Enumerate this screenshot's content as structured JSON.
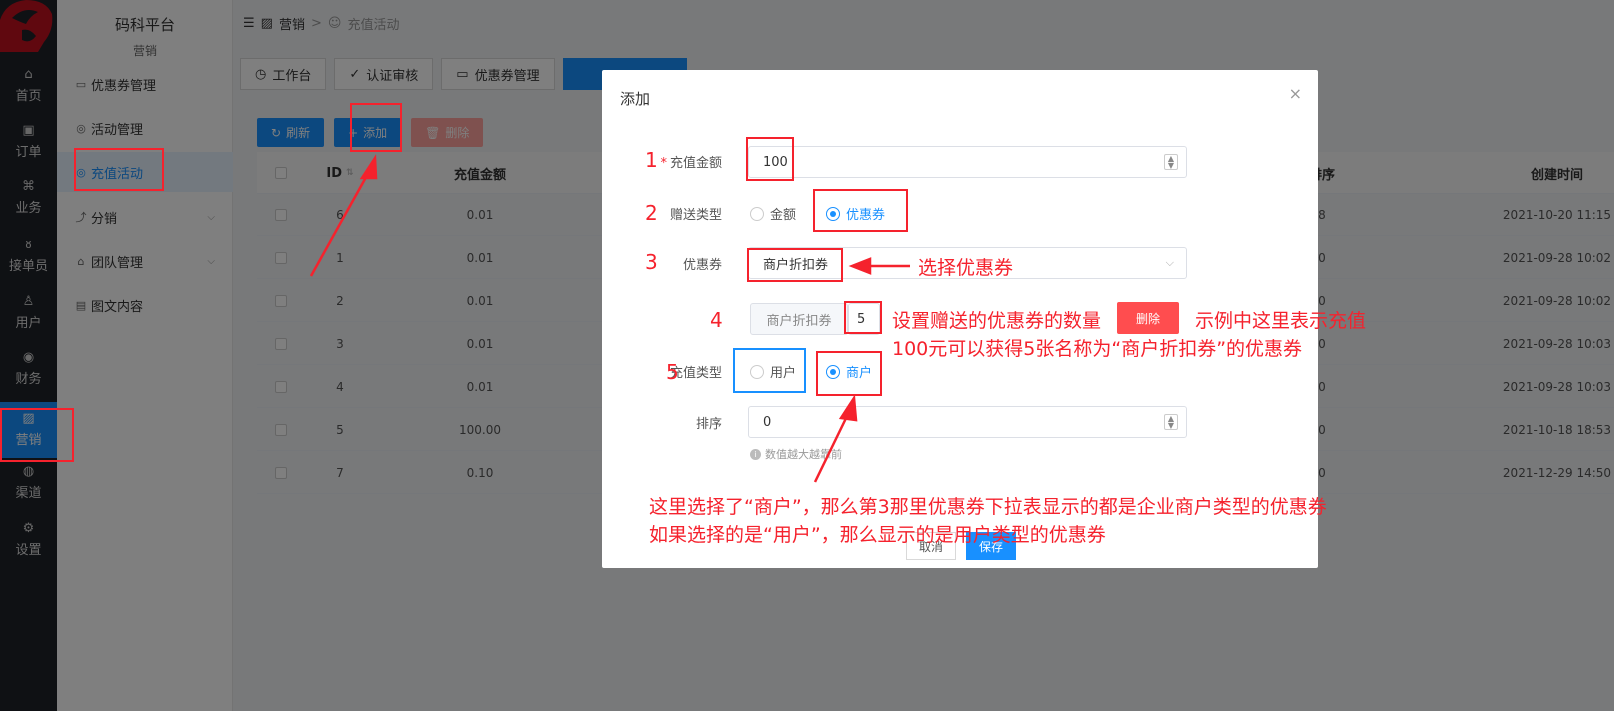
{
  "rail": {
    "items": [
      {
        "label": "首页",
        "icon": "home-icon",
        "glyph": "⌂"
      },
      {
        "label": "订单",
        "icon": "order-icon",
        "glyph": "▣"
      },
      {
        "label": "业务",
        "icon": "business-icon",
        "glyph": "⌘"
      },
      {
        "label": "接单员",
        "icon": "bike-icon",
        "glyph": "ᴕ"
      },
      {
        "label": "用户",
        "icon": "user-icon",
        "glyph": "♙"
      },
      {
        "label": "财务",
        "icon": "finance-icon",
        "glyph": "◉"
      },
      {
        "label": "营销",
        "icon": "marketing-icon",
        "glyph": "▨"
      },
      {
        "label": "渠道",
        "icon": "channel-icon",
        "glyph": "◍"
      },
      {
        "label": "设置",
        "icon": "settings-icon",
        "glyph": "⚙"
      }
    ]
  },
  "menu": {
    "brand": "码科平台",
    "section": "营销",
    "items": [
      {
        "label": "优惠券管理",
        "glyph": "▭"
      },
      {
        "label": "活动管理",
        "glyph": "◎"
      },
      {
        "label": "充值活动",
        "glyph": "◎"
      },
      {
        "label": "分销",
        "glyph": "⤴"
      },
      {
        "label": "团队管理",
        "glyph": "⌂"
      },
      {
        "label": "图文内容",
        "glyph": "▤"
      }
    ]
  },
  "breadcrumb": {
    "first": "营销",
    "sep": ">",
    "second": "充值活动"
  },
  "tabs": [
    {
      "label": "工作台",
      "glyph": "◷"
    },
    {
      "label": "认证审核",
      "glyph": "✓"
    },
    {
      "label": "优惠券管理",
      "glyph": "▭"
    }
  ],
  "toolbar": {
    "refresh": "刷新",
    "add": "添加",
    "delete": "删除"
  },
  "table": {
    "headers": {
      "id": "ID",
      "amount": "充值金额",
      "sort": "排序",
      "created": "创建时间"
    },
    "rows": [
      {
        "id": "6",
        "amount": "0.01",
        "sort": "8",
        "created": "2021-10-20 11:15"
      },
      {
        "id": "1",
        "amount": "0.01",
        "sort": "0",
        "created": "2021-09-28 10:02"
      },
      {
        "id": "2",
        "amount": "0.01",
        "sort": "0",
        "created": "2021-09-28 10:02"
      },
      {
        "id": "3",
        "amount": "0.01",
        "sort": "0",
        "created": "2021-09-28 10:03"
      },
      {
        "id": "4",
        "amount": "0.01",
        "sort": "0",
        "created": "2021-09-28 10:03"
      },
      {
        "id": "5",
        "amount": "100.00",
        "sort": "0",
        "created": "2021-10-18 18:53"
      },
      {
        "id": "7",
        "amount": "0.10",
        "sort": "0",
        "created": "2021-12-29 14:50"
      }
    ]
  },
  "dialog": {
    "title": "添加",
    "close": "×",
    "amount_label": "充值金额",
    "amount_value": "100",
    "gift_type_label": "赠送类型",
    "gift_opt_amount": "金额",
    "gift_opt_coupon": "优惠券",
    "coupon_label": "优惠券",
    "coupon_selected": "商户折扣券",
    "coupon_name": "商户折扣券",
    "coupon_qty": "5",
    "delete_btn": "删除",
    "recharge_type_label": "充值类型",
    "rt_user": "用户",
    "rt_merchant": "商户",
    "sort_label": "排序",
    "sort_value": "0",
    "hint": "数值越大越靠前",
    "cancel": "取消",
    "save": "保存"
  },
  "annotations": {
    "n1": "1",
    "n2": "2",
    "n3": "3",
    "n4": "4",
    "n5": "5",
    "select_coupon": "选择优惠券",
    "qty_note_a": "设置赠送的优惠券的数量",
    "qty_note_b": "示例中这里表示充值",
    "qty_note_c": "100元可以获得5张名称为“商户折扣券”的优惠券",
    "merchant_note_1": "这里选择了“商户”，那么第3那里优惠券下拉表显示的都是企业商户类型的优惠券",
    "merchant_note_2": "如果选择的是“用户”，那么显示的是用户类型的优惠券"
  },
  "colors": {
    "accent": "#1890ff",
    "annotation": "#f5222d",
    "rail": "#1f2329"
  }
}
